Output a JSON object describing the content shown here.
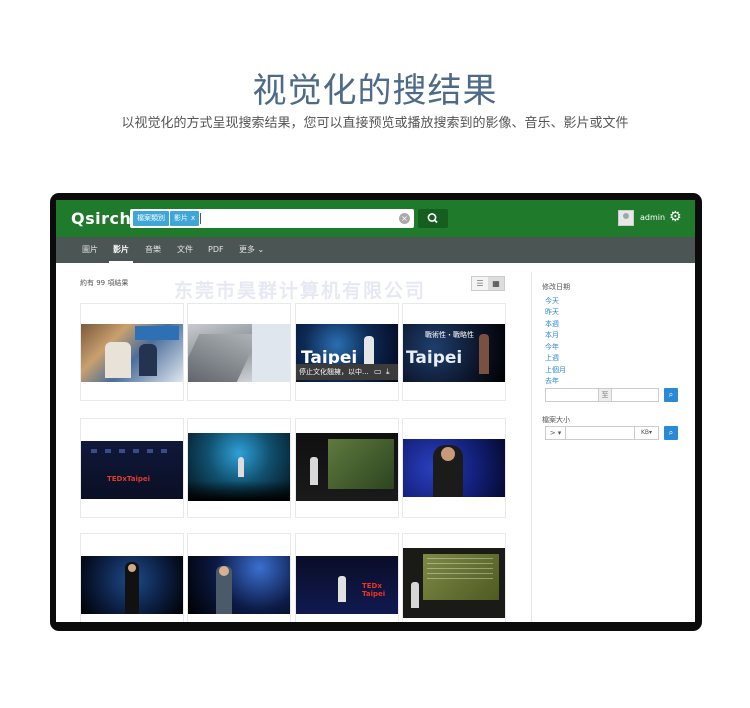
{
  "hero": {
    "title": "视觉化的搜结果",
    "subtitle": "以视觉化的方式呈现搜索结果，您可以直接预览或播放搜索到的影像、音乐、影片或文件"
  },
  "app": {
    "logo": "Qsirch",
    "search": {
      "chips": [
        "檔案類別",
        "影片"
      ],
      "chip_close": "x",
      "value": ""
    },
    "user": "admin",
    "tabs": [
      "圖片",
      "影片",
      "音樂",
      "文件",
      "PDF",
      "更多"
    ],
    "active_tab": "影片",
    "result_count": "約有 99 項結果",
    "watermark": "东莞市昊群计算机有限公司",
    "thumbs": [
      {
        "kind": "office"
      },
      {
        "kind": "escalator"
      },
      {
        "kind": "stage",
        "text": "Taipei",
        "hover_label": "停止文化翹擁，以中..."
      },
      {
        "kind": "stage2",
        "text": "Taipei",
        "caption": "戰術性・戰略性"
      },
      {
        "kind": "tedx",
        "text": "TEDxTaipei"
      },
      {
        "kind": "blue-stage"
      },
      {
        "kind": "dark-stage"
      },
      {
        "kind": "speaker-blue"
      },
      {
        "kind": "speaker-woman"
      },
      {
        "kind": "speaker-man"
      },
      {
        "kind": "stage-red",
        "text": "TEDx Taipei"
      },
      {
        "kind": "slide"
      }
    ],
    "filters": {
      "date_title": "修改日期",
      "date_links": [
        "今天",
        "昨天",
        "本週",
        "本月",
        "今年",
        "上週",
        "上個月",
        "去年"
      ],
      "range_sep": "至",
      "size_title": "檔案大小",
      "size_op": ">",
      "size_unit": "KB"
    }
  },
  "colors": {
    "topbar": "#1f7a2c",
    "subnav": "#4b5553",
    "link": "#2b8ad6",
    "hero_title": "#4d6a86"
  }
}
